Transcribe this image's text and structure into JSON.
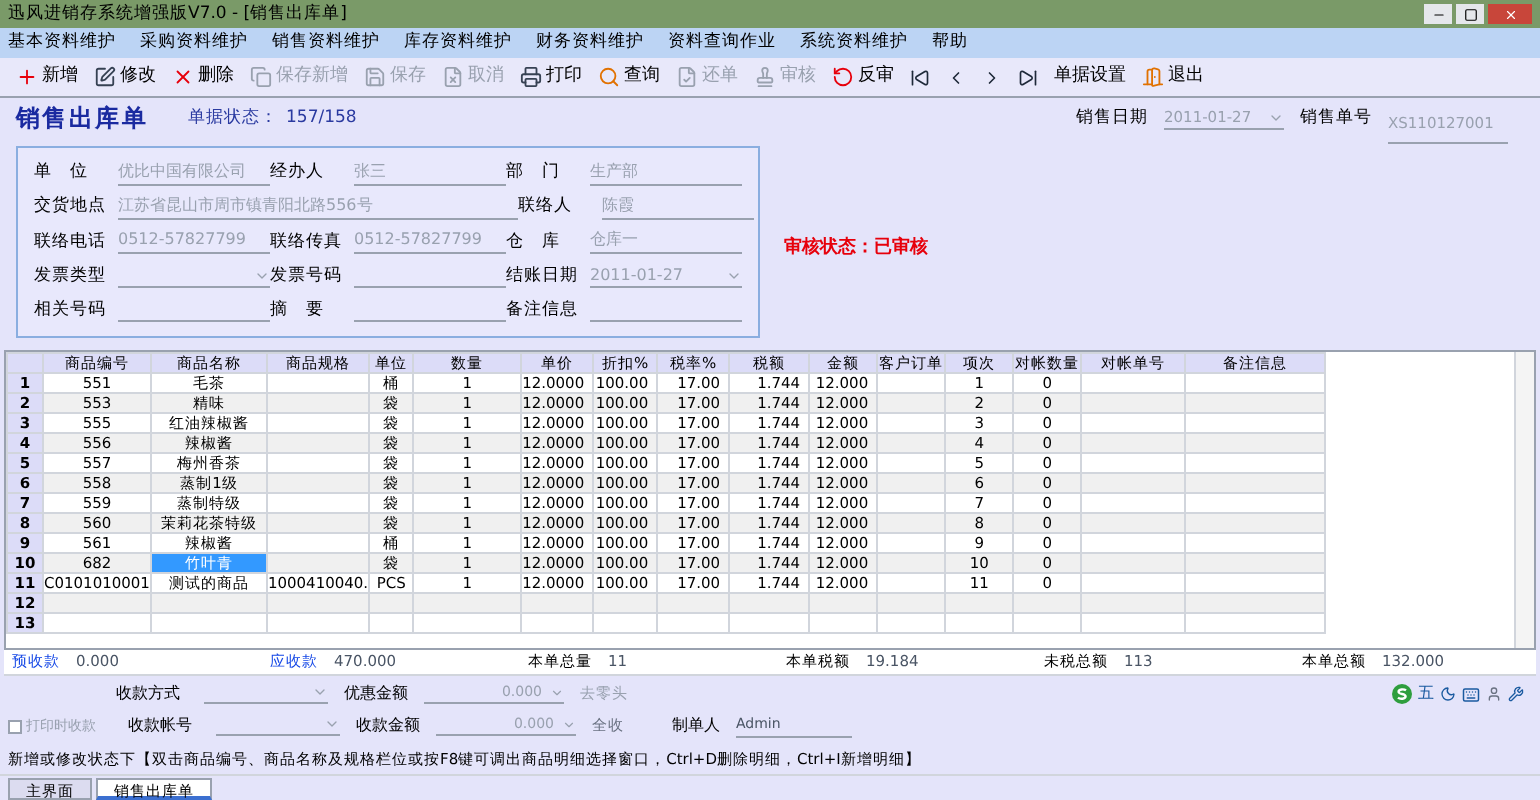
{
  "window": {
    "title": "迅风进销存系统增强版V7.0 - [销售出库单]"
  },
  "menu": [
    "基本资料维护",
    "采购资料维护",
    "销售资料维护",
    "库存资料维护",
    "财务资料维护",
    "资料查询作业",
    "系统资料维护",
    "帮助"
  ],
  "toolbar": [
    {
      "kind": "button",
      "label": "新增",
      "disabled": false
    },
    {
      "kind": "button",
      "label": "修改",
      "disabled": false
    },
    {
      "kind": "button",
      "label": "删除",
      "disabled": false
    },
    {
      "kind": "button",
      "label": "保存新增",
      "disabled": true
    },
    {
      "kind": "button",
      "label": "保存",
      "disabled": true
    },
    {
      "kind": "button",
      "label": "取消",
      "disabled": true
    },
    {
      "kind": "button",
      "label": "打印",
      "disabled": false
    },
    {
      "kind": "button",
      "label": "查询",
      "disabled": false
    },
    {
      "kind": "button",
      "label": "还单",
      "disabled": true
    },
    {
      "kind": "button",
      "label": "审核",
      "disabled": true
    },
    {
      "kind": "button",
      "label": "反审",
      "disabled": false
    },
    {
      "kind": "nav",
      "disabled": false
    },
    {
      "kind": "nav",
      "disabled": false
    },
    {
      "kind": "nav",
      "disabled": false
    },
    {
      "kind": "nav",
      "disabled": false
    },
    {
      "kind": "button",
      "label": "单据设置",
      "disabled": false
    },
    {
      "kind": "button",
      "label": "退出",
      "disabled": false
    }
  ],
  "header": {
    "title": "销售出库单",
    "status_label": "单据状态：",
    "status_value": "157/158",
    "date_label": "销售日期",
    "date_value": "2011-01-27",
    "number_label": "销售单号",
    "number_value": "XS110127001"
  },
  "form": [
    [
      {
        "label": "单　位",
        "value": "优比中国有限公司",
        "kind": "text"
      },
      {
        "label": "经办人",
        "value": "张三",
        "kind": "text"
      },
      {
        "label": "部　门",
        "value": "生产部",
        "kind": "text"
      }
    ],
    [
      {
        "label": "交货地点",
        "value": "江苏省昆山市周市镇青阳北路556号",
        "kind": "wide"
      },
      {
        "label": "联络人",
        "value": "陈霞",
        "kind": "text"
      }
    ],
    [
      {
        "label": "联络电话",
        "value": "0512-57827799",
        "kind": "text"
      },
      {
        "label": "联络传真",
        "value": "0512-57827799",
        "kind": "text"
      },
      {
        "label": "仓　库",
        "value": "仓库一",
        "kind": "text"
      }
    ],
    [
      {
        "label": "发票类型",
        "kind": "select"
      },
      {
        "label": "发票号码",
        "kind": "text"
      },
      {
        "label": "结账日期",
        "value": "2011-01-27",
        "kind": "select"
      }
    ],
    [
      {
        "label": "相关号码",
        "kind": "text"
      },
      {
        "label": "摘　要",
        "kind": "text"
      },
      {
        "label": "备注信息",
        "kind": "text"
      }
    ]
  ],
  "audit_status": "审核状态：已审核",
  "table": {
    "columns": [
      "商品编号",
      "商品名称",
      "商品规格",
      "单位",
      "数量",
      "单价",
      "折扣%",
      "税率%",
      "税额",
      "金额",
      "客户订单",
      "项次",
      "对帐数量",
      "对帐单号",
      "备注信息"
    ],
    "rows": [
      {
        "no": "1",
        "selected": false,
        "cells": [
          "551",
          "毛茶",
          "",
          "桶",
          "1",
          "12.0000",
          "100.00",
          "17.00",
          "1.744",
          "12.000",
          "",
          "1",
          "0",
          "",
          ""
        ]
      },
      {
        "no": "2",
        "selected": false,
        "cells": [
          "553",
          "精味",
          "",
          "袋",
          "1",
          "12.0000",
          "100.00",
          "17.00",
          "1.744",
          "12.000",
          "",
          "2",
          "0",
          "",
          ""
        ]
      },
      {
        "no": "3",
        "selected": false,
        "cells": [
          "555",
          "红油辣椒酱",
          "",
          "袋",
          "1",
          "12.0000",
          "100.00",
          "17.00",
          "1.744",
          "12.000",
          "",
          "3",
          "0",
          "",
          ""
        ]
      },
      {
        "no": "4",
        "selected": false,
        "cells": [
          "556",
          "辣椒酱",
          "",
          "袋",
          "1",
          "12.0000",
          "100.00",
          "17.00",
          "1.744",
          "12.000",
          "",
          "4",
          "0",
          "",
          ""
        ]
      },
      {
        "no": "5",
        "selected": false,
        "cells": [
          "557",
          "梅州香茶",
          "",
          "袋",
          "1",
          "12.0000",
          "100.00",
          "17.00",
          "1.744",
          "12.000",
          "",
          "5",
          "0",
          "",
          ""
        ]
      },
      {
        "no": "6",
        "selected": false,
        "cells": [
          "558",
          "蒸制1级",
          "",
          "袋",
          "1",
          "12.0000",
          "100.00",
          "17.00",
          "1.744",
          "12.000",
          "",
          "6",
          "0",
          "",
          ""
        ]
      },
      {
        "no": "7",
        "selected": false,
        "cells": [
          "559",
          "蒸制特级",
          "",
          "袋",
          "1",
          "12.0000",
          "100.00",
          "17.00",
          "1.744",
          "12.000",
          "",
          "7",
          "0",
          "",
          ""
        ]
      },
      {
        "no": "8",
        "selected": false,
        "cells": [
          "560",
          "茉莉花茶特级",
          "",
          "袋",
          "1",
          "12.0000",
          "100.00",
          "17.00",
          "1.744",
          "12.000",
          "",
          "8",
          "0",
          "",
          ""
        ]
      },
      {
        "no": "9",
        "selected": false,
        "cells": [
          "561",
          "辣椒酱",
          "",
          "桶",
          "1",
          "12.0000",
          "100.00",
          "17.00",
          "1.744",
          "12.000",
          "",
          "9",
          "0",
          "",
          ""
        ]
      },
      {
        "no": "10",
        "selected": true,
        "cells": [
          "682",
          "竹叶青",
          "",
          "袋",
          "1",
          "12.0000",
          "100.00",
          "17.00",
          "1.744",
          "12.000",
          "",
          "10",
          "0",
          "",
          ""
        ]
      },
      {
        "no": "11",
        "selected": false,
        "cells": [
          "C0101010001",
          "测试的商品",
          "1000410040.",
          "PCS",
          "1",
          "12.0000",
          "100.00",
          "17.00",
          "1.744",
          "12.000",
          "",
          "11",
          "0",
          "",
          ""
        ]
      },
      {
        "no": "12",
        "selected": false,
        "cells": [
          "",
          "",
          "",
          "",
          "",
          "",
          "",
          "",
          "",
          "",
          "",
          "",
          "",
          "",
          ""
        ]
      },
      {
        "no": "13",
        "selected": false,
        "cells": [
          "",
          "",
          "",
          "",
          "",
          "",
          "",
          "",
          "",
          "",
          "",
          "",
          "",
          "",
          ""
        ]
      }
    ]
  },
  "summary": [
    {
      "label": "预收款",
      "value": "0.000",
      "link": true
    },
    {
      "label": "应收款",
      "value": "470.000",
      "link": true
    },
    {
      "label": "本单总量",
      "value": "11",
      "link": false
    },
    {
      "label": "本单税额",
      "value": "19.184",
      "link": false
    },
    {
      "label": "未税总额",
      "value": "113",
      "link": false
    },
    {
      "label": "本单总额",
      "value": "132.000",
      "link": false
    }
  ],
  "payment": {
    "method_label": "收款方式",
    "discount_label": "优惠金额",
    "discount_value": "0.000",
    "discount_button": "去零头",
    "print_checkbox": {
      "label": "打印时收款",
      "checked": false
    },
    "account_label": "收款帐号",
    "amount_label": "收款金额",
    "amount_value": "0.000",
    "amount_button": "全收",
    "creator_label": "制单人",
    "creator_value": "Admin"
  },
  "ime_bar": {
    "mode": "五"
  },
  "status_bar": "新增或修改状态下【双击商品编号、商品名称及规格栏位或按F8键可调出商品明细选择窗口，Ctrl+D删除明细，Ctrl+I新增明细】",
  "tabs": [
    {
      "label": "主界面",
      "selected": false
    },
    {
      "label": "销售出库单",
      "selected": true
    }
  ]
}
